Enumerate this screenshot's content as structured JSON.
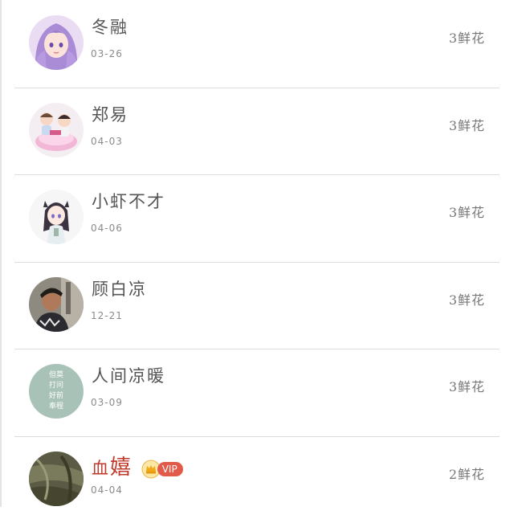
{
  "list": {
    "items": [
      {
        "name": "冬融",
        "date": "03-26",
        "flowers": "3鲜花",
        "avatar": "anime-purple-hair-avatar"
      },
      {
        "name": "郑易",
        "date": "04-03",
        "flowers": "3鲜花",
        "avatar": "cartoon-couple-cake-avatar"
      },
      {
        "name": "小虾不才",
        "date": "04-06",
        "flowers": "3鲜花",
        "avatar": "anime-chibi-girl-avatar"
      },
      {
        "name": "顾白凉",
        "date": "12-21",
        "flowers": "3鲜花",
        "avatar": "photo-boy-avatar"
      },
      {
        "name": "人间凉暖",
        "date": "03-09",
        "flowers": "3鲜花",
        "avatar": "text-tile-avatar",
        "avatar_text": [
          "但莫",
          "打问",
          "好前",
          "奉程"
        ]
      },
      {
        "name_prefix": "血",
        "name_big": "嬉",
        "date": "04-04",
        "flowers": "2鲜花",
        "vip_label": "VIP",
        "avatar": "photo-cloth-avatar"
      }
    ]
  },
  "colors": {
    "divider": "#dcdcdc",
    "vip_name": "#c0392b",
    "vip_badge": "#e25a4a",
    "text_tile_bg": "#a9c2b8"
  }
}
